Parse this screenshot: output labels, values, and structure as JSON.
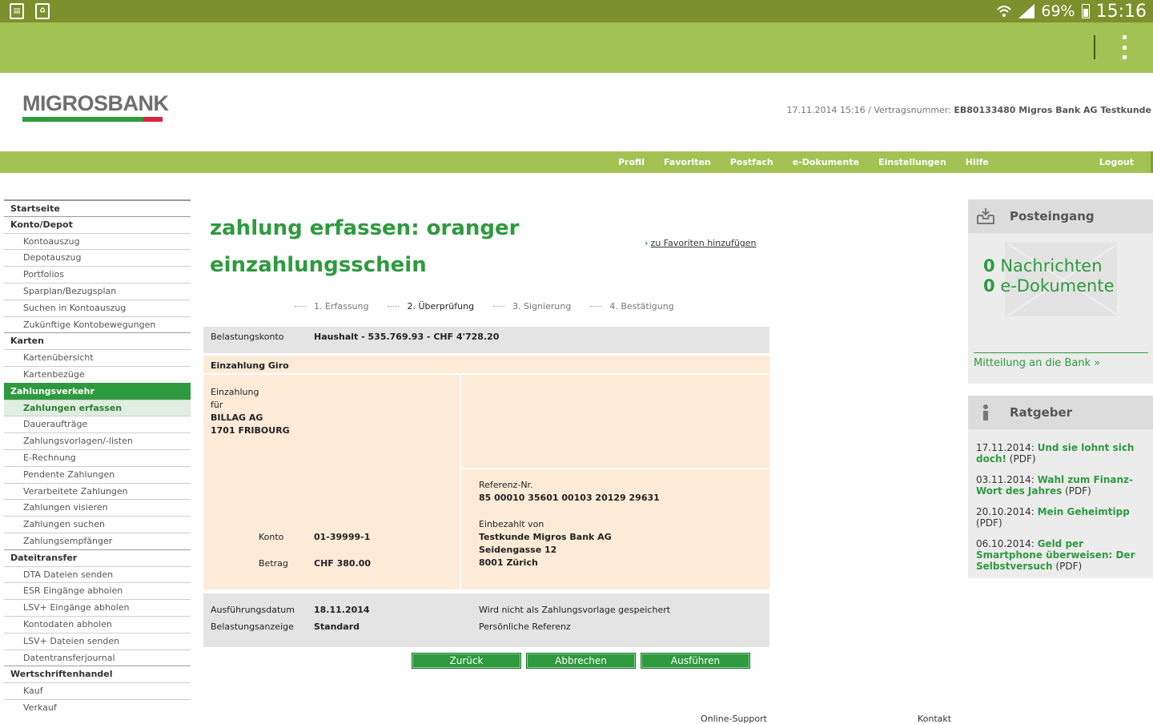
{
  "status_bar": {
    "battery": "69%",
    "time": "15:16"
  },
  "header": {
    "logo": "MIGROSBANK",
    "contract_prefix": "17.11.2014 15:16 / Vertragsnummer: ",
    "contract_value": "EB80133480 Migros Bank AG Testkunde"
  },
  "topnav": {
    "items": [
      "Profil",
      "Favoriten",
      "Postfach",
      "e-Dokumente",
      "Einstellungen",
      "Hilfe"
    ],
    "logout": "Logout"
  },
  "sidebar": {
    "items": [
      {
        "label": "Startseite",
        "type": "sec"
      },
      {
        "label": "Konto/Depot",
        "type": "sec"
      },
      {
        "label": "Kontoauszug",
        "type": "sub"
      },
      {
        "label": "Depotauszug",
        "type": "sub"
      },
      {
        "label": "Portfolios",
        "type": "sub"
      },
      {
        "label": "Sparplan/Bezugsplan",
        "type": "sub"
      },
      {
        "label": "Suchen in Kontoauszug",
        "type": "sub"
      },
      {
        "label": "Zukünftige Kontobewegungen",
        "type": "sub"
      },
      {
        "label": "Karten",
        "type": "sec"
      },
      {
        "label": "Kartenübersicht",
        "type": "sub"
      },
      {
        "label": "Kartenbezüge",
        "type": "sub"
      },
      {
        "label": "Zahlungsverkehr",
        "type": "sec-active"
      },
      {
        "label": "Zahlungen erfassen",
        "type": "sub-active"
      },
      {
        "label": "Daueraufträge",
        "type": "sub"
      },
      {
        "label": "Zahlungsvorlagen/-listen",
        "type": "sub"
      },
      {
        "label": "E-Rechnung",
        "type": "sub"
      },
      {
        "label": "Pendente Zahlungen",
        "type": "sub"
      },
      {
        "label": "Verarbeitete Zahlungen",
        "type": "sub"
      },
      {
        "label": "Zahlungen visieren",
        "type": "sub"
      },
      {
        "label": "Zahlungen suchen",
        "type": "sub"
      },
      {
        "label": "Zahlungsempfänger",
        "type": "sub"
      },
      {
        "label": "Dateitransfer",
        "type": "sec"
      },
      {
        "label": "DTA Dateien senden",
        "type": "sub"
      },
      {
        "label": "ESR Eingänge abholen",
        "type": "sub"
      },
      {
        "label": "LSV+ Eingänge abholen",
        "type": "sub"
      },
      {
        "label": "Kontodaten abholen",
        "type": "sub"
      },
      {
        "label": "LSV+ Dateien senden",
        "type": "sub"
      },
      {
        "label": "Datentransferjournal",
        "type": "sub"
      },
      {
        "label": "Wertschriftenhandel",
        "type": "sec"
      },
      {
        "label": "Kauf",
        "type": "sub"
      },
      {
        "label": "Verkauf",
        "type": "sub"
      }
    ]
  },
  "main": {
    "title_line1": "zahlung erfassen: oranger",
    "title_line2": "einzahlungsschein",
    "fav_link": "zu Favoriten hinzufügen",
    "steps": [
      "1. Erfassung",
      "2. Überprüfung",
      "3. Signierung",
      "4. Bestätigung"
    ],
    "current_step": 1,
    "belastungskonto_label": "Belastungskonto",
    "belastungskonto_value": "Haushalt - 535.769.93 - CHF 4'728.20",
    "giro_title": "Einzahlung Giro",
    "einzahlung_label_1": "Einzahlung",
    "einzahlung_label_2": "für",
    "payee_1": "BILLAG AG",
    "payee_2": "1701 FRIBOURG",
    "konto_label": "Konto",
    "konto_value": "01-39999-1",
    "betrag_label": "Betrag",
    "betrag_value": "CHF 380.00",
    "referenz_label": "Referenz-Nr.",
    "referenz_value": "85 00010 35601 00103 20129 29631",
    "einbezahlt_label": "Einbezahlt von",
    "einbezahlt_1": "Testkunde Migros Bank AG",
    "einbezahlt_2": "Seidengasse 12",
    "einbezahlt_3": "8001 Zürich",
    "ausfuehrung_label": "Ausführungsdatum",
    "ausfuehrung_value": "18.11.2014",
    "belastungsanzeige_label": "Belastungsanzeige",
    "belastungsanzeige_value": "Standard",
    "vorlage_note": "Wird nicht als Zahlungsvorlage gespeichert",
    "persoenliche_referenz": "Persönliche Referenz",
    "btn_back": "Zurück",
    "btn_cancel": "Abbrechen",
    "btn_execute": "Ausführen"
  },
  "footer": {
    "support": "Online-Support",
    "contact": "Kontakt"
  },
  "posteingang": {
    "title": "Posteingang",
    "messages_count": "0",
    "messages_label": "Nachrichten",
    "docs_count": "0",
    "docs_label": "e-Dokumente",
    "link": "Mitteilung an die Bank"
  },
  "ratgeber": {
    "title": "Ratgeber",
    "entries": [
      {
        "date": "17.11.2014: ",
        "link": "Und sie lohnt sich doch!",
        "suffix": " (PDF)"
      },
      {
        "date": "03.11.2014: ",
        "link": "Wahl zum Finanz-Wort des Jahres",
        "suffix": " (PDF)"
      },
      {
        "date": "20.10.2014: ",
        "link": "Mein Geheimtipp",
        "suffix": " (PDF)"
      },
      {
        "date": "06.10.2014: ",
        "link": "Geld per Smartphone überweisen: Der Selbstversuch",
        "suffix": " (PDF)"
      }
    ]
  },
  "colors": {
    "brand_green": "#2e9a3e",
    "bar_green": "#a2c254",
    "status_green": "#7e8f2d",
    "logo_red": "#d7263d",
    "panel_orange": "#fdebd8"
  },
  "icons": [
    "image-icon",
    "recycle-icon",
    "wifi-icon",
    "signal-icon",
    "battery-icon",
    "overflow-menu-icon",
    "chevron-right-icon",
    "inbox-icon",
    "info-icon",
    "envelope-icon",
    "double-chevron-icon"
  ]
}
